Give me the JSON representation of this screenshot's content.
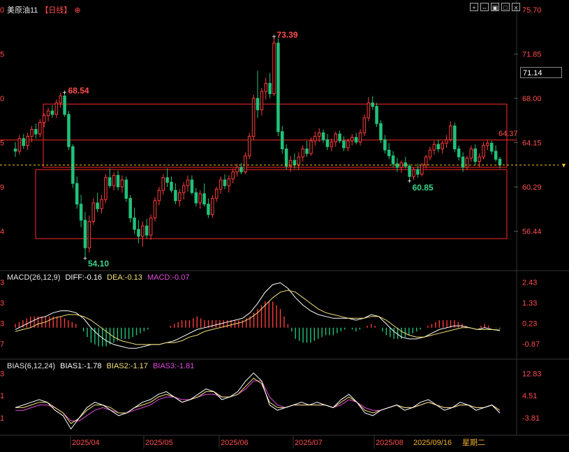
{
  "header": {
    "symbol": "美原油11",
    "period": "【日线】",
    "toolbar_icons": [
      "crosshair-icon",
      "expand-icon",
      "image-icon",
      "maximize-icon",
      "close-icon"
    ]
  },
  "price_panel": {
    "y_axis_labels": [
      "75.70",
      "71.85",
      "68.00",
      "64.15",
      "60.29",
      "56.44"
    ],
    "left_axis_partial": [
      "0",
      "5",
      "0",
      "5",
      "9",
      "4"
    ],
    "current_price": "71.14",
    "high_label": "73.39",
    "high_left_label": "68.54",
    "low_label": "54.10",
    "low_right_label": "60.85",
    "box_top_label": "64.37"
  },
  "macd_panel": {
    "title": "MACD(26,12,9)",
    "diff": "DIFF:-0.16",
    "dea": "DEA:-0.13",
    "macd": "MACD:-0.07",
    "y_axis_labels": [
      "2.43",
      "1.33",
      "0.23",
      "-0.87"
    ],
    "left_axis_partial": [
      "3",
      "3",
      "3",
      "7"
    ]
  },
  "bias_panel": {
    "title": "BIAS(6,12,24)",
    "bias1": "BIAS1:-1.78",
    "bias2": "BIAS2:-1.17",
    "bias3": "BIAS3:-1.81",
    "y_axis_labels": [
      "12.83",
      "4.51",
      "-3.81"
    ],
    "left_axis_partial": [
      "3",
      "1",
      "1"
    ]
  },
  "x_axis": {
    "labels": [
      "2025/04",
      "2025/05",
      "2025/06",
      "2025/07",
      "2025/08"
    ],
    "current_date": "2025/09/16",
    "weekday": "星期二"
  },
  "colors": {
    "up": "#ff3b3b",
    "down": "#21c27a",
    "diff": "#ffffff",
    "dea": "#f5e27a",
    "macd": "#e54be0",
    "bias1": "#ffffff",
    "bias2": "#f5e27a",
    "bias3": "#e54be0",
    "box": "#ff2a2a",
    "axis_text": "#ff4d4d",
    "label_up": "#ff4d4d",
    "label_down": "#3bd48a"
  },
  "chart_data": {
    "type": "candlestick",
    "price_range": [
      53.5,
      75.7
    ],
    "candles": [
      [
        63.6,
        64.2,
        62.9,
        63.4
      ],
      [
        63.4,
        64.8,
        63.1,
        64.5
      ],
      [
        64.5,
        64.9,
        63.6,
        63.9
      ],
      [
        63.9,
        65.0,
        63.5,
        64.7
      ],
      [
        64.7,
        65.6,
        64.2,
        65.3
      ],
      [
        65.3,
        65.8,
        64.5,
        64.9
      ],
      [
        64.9,
        66.2,
        64.6,
        65.9
      ],
      [
        65.9,
        66.7,
        65.5,
        66.5
      ],
      [
        66.5,
        67.2,
        66.0,
        66.9
      ],
      [
        66.9,
        67.4,
        66.3,
        66.6
      ],
      [
        66.6,
        67.9,
        66.3,
        67.6
      ],
      [
        67.6,
        68.5,
        67.2,
        68.2
      ],
      [
        68.2,
        68.54,
        66.4,
        66.6
      ],
      [
        66.6,
        66.9,
        63.5,
        63.8
      ],
      [
        63.8,
        64.0,
        60.2,
        60.6
      ],
      [
        60.6,
        61.2,
        58.4,
        58.8
      ],
      [
        58.8,
        59.6,
        56.8,
        57.4
      ],
      [
        57.4,
        58.1,
        54.1,
        55.0
      ],
      [
        55.0,
        57.8,
        54.6,
        57.3
      ],
      [
        57.3,
        59.3,
        57.0,
        58.9
      ],
      [
        58.9,
        59.8,
        58.1,
        58.4
      ],
      [
        58.4,
        59.6,
        58.0,
        59.2
      ],
      [
        59.2,
        61.4,
        58.9,
        61.1
      ],
      [
        61.1,
        61.9,
        60.2,
        60.4
      ],
      [
        60.4,
        61.6,
        60.0,
        61.3
      ],
      [
        61.3,
        61.7,
        60.0,
        60.3
      ],
      [
        60.3,
        61.3,
        59.8,
        60.9
      ],
      [
        60.9,
        61.2,
        59.0,
        59.3
      ],
      [
        59.3,
        59.6,
        57.2,
        57.6
      ],
      [
        57.6,
        58.5,
        56.2,
        56.6
      ],
      [
        56.6,
        57.4,
        55.4,
        56.0
      ],
      [
        56.0,
        57.3,
        55.1,
        56.9
      ],
      [
        56.9,
        57.5,
        55.8,
        56.1
      ],
      [
        56.1,
        57.9,
        55.7,
        57.6
      ],
      [
        57.6,
        59.4,
        57.3,
        59.1
      ],
      [
        59.1,
        60.3,
        58.7,
        60.0
      ],
      [
        60.0,
        61.4,
        59.6,
        61.1
      ],
      [
        61.1,
        61.9,
        60.3,
        60.7
      ],
      [
        60.7,
        61.2,
        59.8,
        60.0
      ],
      [
        60.0,
        60.6,
        58.8,
        59.1
      ],
      [
        59.1,
        60.1,
        58.6,
        59.8
      ],
      [
        59.8,
        60.7,
        59.2,
        60.4
      ],
      [
        60.4,
        61.3,
        59.9,
        60.9
      ],
      [
        60.9,
        61.3,
        59.6,
        59.8
      ],
      [
        59.8,
        60.2,
        58.6,
        58.9
      ],
      [
        58.9,
        60.0,
        58.4,
        59.7
      ],
      [
        59.7,
        60.6,
        58.6,
        58.8
      ],
      [
        58.8,
        59.3,
        57.6,
        57.9
      ],
      [
        57.9,
        59.6,
        57.6,
        59.3
      ],
      [
        59.3,
        60.3,
        59.0,
        60.1
      ],
      [
        60.1,
        61.2,
        59.7,
        60.9
      ],
      [
        60.9,
        61.4,
        60.1,
        60.4
      ],
      [
        60.4,
        61.3,
        59.8,
        61.0
      ],
      [
        61.0,
        61.9,
        60.6,
        61.6
      ],
      [
        61.6,
        62.3,
        61.2,
        62.0
      ],
      [
        62.0,
        62.4,
        61.4,
        61.6
      ],
      [
        61.6,
        63.3,
        61.4,
        63.0
      ],
      [
        63.0,
        65.0,
        62.7,
        64.7
      ],
      [
        64.7,
        68.3,
        64.4,
        68.0
      ],
      [
        68.0,
        70.4,
        66.3,
        67.0
      ],
      [
        67.0,
        68.9,
        66.5,
        68.6
      ],
      [
        68.6,
        69.8,
        67.9,
        69.3
      ],
      [
        69.3,
        70.2,
        68.0,
        68.4
      ],
      [
        68.4,
        73.39,
        68.2,
        72.8
      ],
      [
        72.8,
        73.2,
        64.7,
        65.1
      ],
      [
        65.1,
        65.6,
        63.2,
        63.6
      ],
      [
        63.6,
        64.0,
        61.8,
        62.1
      ],
      [
        62.1,
        63.0,
        61.6,
        62.6
      ],
      [
        62.6,
        63.2,
        61.9,
        62.2
      ],
      [
        62.2,
        63.3,
        61.8,
        62.9
      ],
      [
        62.9,
        63.9,
        62.5,
        63.6
      ],
      [
        63.6,
        64.3,
        62.9,
        63.2
      ],
      [
        63.2,
        64.6,
        63.0,
        64.3
      ],
      [
        64.3,
        65.1,
        63.9,
        64.7
      ],
      [
        64.7,
        65.4,
        64.2,
        65.0
      ],
      [
        65.0,
        65.3,
        64.1,
        64.4
      ],
      [
        64.4,
        64.9,
        63.5,
        63.8
      ],
      [
        63.8,
        64.5,
        63.4,
        64.2
      ],
      [
        64.2,
        65.1,
        63.8,
        64.9
      ],
      [
        64.9,
        65.2,
        64.1,
        64.3
      ],
      [
        64.3,
        64.7,
        63.4,
        63.7
      ],
      [
        63.7,
        64.5,
        63.4,
        64.3
      ],
      [
        64.3,
        64.9,
        63.9,
        64.6
      ],
      [
        64.6,
        65.0,
        64.0,
        64.2
      ],
      [
        64.2,
        65.3,
        63.9,
        65.0
      ],
      [
        65.0,
        66.6,
        64.7,
        66.3
      ],
      [
        66.3,
        68.1,
        66.0,
        67.6
      ],
      [
        67.6,
        68.2,
        67.0,
        67.3
      ],
      [
        67.3,
        67.6,
        65.5,
        65.8
      ],
      [
        65.8,
        66.1,
        64.1,
        64.4
      ],
      [
        64.4,
        64.8,
        63.2,
        63.5
      ],
      [
        63.5,
        64.1,
        62.7,
        63.0
      ],
      [
        63.0,
        63.4,
        62.0,
        62.3
      ],
      [
        62.3,
        62.8,
        61.6,
        62.0
      ],
      [
        62.0,
        62.6,
        61.5,
        62.4
      ],
      [
        62.4,
        62.9,
        61.9,
        62.1
      ],
      [
        62.1,
        62.3,
        60.85,
        61.2
      ],
      [
        61.2,
        62.0,
        60.9,
        61.8
      ],
      [
        61.8,
        62.3,
        61.1,
        61.4
      ],
      [
        61.4,
        62.4,
        61.2,
        62.2
      ],
      [
        62.2,
        63.1,
        61.9,
        62.9
      ],
      [
        62.9,
        63.8,
        62.6,
        63.5
      ],
      [
        63.5,
        64.3,
        63.1,
        64.0
      ],
      [
        64.0,
        64.4,
        63.3,
        63.6
      ],
      [
        63.6,
        64.3,
        63.2,
        64.1
      ],
      [
        64.1,
        64.8,
        63.7,
        64.4
      ],
      [
        64.4,
        66.0,
        64.2,
        65.6
      ],
      [
        65.6,
        65.9,
        63.3,
        63.6
      ],
      [
        63.6,
        63.9,
        62.6,
        62.9
      ],
      [
        62.9,
        63.3,
        61.6,
        62.0
      ],
      [
        62.0,
        63.0,
        61.8,
        62.8
      ],
      [
        62.8,
        63.9,
        62.5,
        63.6
      ],
      [
        63.6,
        64.0,
        62.2,
        62.5
      ],
      [
        62.5,
        63.2,
        62.0,
        62.9
      ],
      [
        62.9,
        64.2,
        62.7,
        63.9
      ],
      [
        63.9,
        64.37,
        63.5,
        64.1
      ],
      [
        64.1,
        64.3,
        63.1,
        63.4
      ],
      [
        63.4,
        63.9,
        62.5,
        62.7
      ],
      [
        62.7,
        62.9,
        61.9,
        62.2
      ]
    ],
    "box1_range": [
      62.0,
      67.5
    ],
    "box2_range": [
      55.8,
      61.8
    ],
    "macd": {
      "range": [
        -1.5,
        2.6
      ],
      "diff_points": [
        -0.1,
        0.1,
        0.3,
        0.5,
        0.6,
        0.8,
        0.9,
        0.9,
        0.8,
        0.5,
        0.0,
        -0.4,
        -0.7,
        -0.9,
        -1.0,
        -1.1,
        -1.1,
        -1.0,
        -0.9,
        -0.9,
        -0.8,
        -0.7,
        -0.5,
        -0.3,
        -0.1,
        0.0,
        0.1,
        0.2,
        0.3,
        0.4,
        0.5,
        0.8,
        1.3,
        1.9,
        2.3,
        2.4,
        2.1,
        1.6,
        1.2,
        0.9,
        0.7,
        0.6,
        0.5,
        0.5,
        0.5,
        0.4,
        0.5,
        0.7,
        0.6,
        0.2,
        -0.2,
        -0.5,
        -0.6,
        -0.6,
        -0.5,
        -0.3,
        -0.1,
        0.0,
        0.1,
        0.1,
        0.0,
        -0.1,
        0.0,
        -0.1,
        -0.16
      ],
      "dea_points": [
        -0.2,
        -0.1,
        0.0,
        0.2,
        0.3,
        0.5,
        0.6,
        0.7,
        0.7,
        0.6,
        0.4,
        0.1,
        -0.2,
        -0.5,
        -0.7,
        -0.8,
        -0.9,
        -0.9,
        -0.9,
        -0.9,
        -0.8,
        -0.8,
        -0.7,
        -0.5,
        -0.4,
        -0.2,
        -0.1,
        0.0,
        0.1,
        0.2,
        0.3,
        0.5,
        0.8,
        1.2,
        1.6,
        1.9,
        2.0,
        1.9,
        1.6,
        1.3,
        1.0,
        0.8,
        0.7,
        0.6,
        0.5,
        0.5,
        0.5,
        0.6,
        0.6,
        0.4,
        0.1,
        -0.2,
        -0.4,
        -0.5,
        -0.5,
        -0.4,
        -0.3,
        -0.2,
        -0.1,
        0.0,
        0.0,
        -0.1,
        -0.1,
        -0.1,
        -0.13
      ]
    },
    "bias": {
      "range": [
        -8,
        15
      ],
      "bias1_points": [
        0,
        1,
        2,
        3,
        2,
        -1,
        -3,
        -8,
        -4,
        0,
        2,
        1,
        -1,
        -3,
        -2,
        0,
        2,
        3,
        5,
        6,
        4,
        2,
        3,
        5,
        7,
        6,
        3,
        4,
        6,
        10,
        13,
        10,
        1,
        -1,
        0,
        1,
        2,
        1,
        2,
        1,
        0,
        3,
        5,
        2,
        -2,
        -3,
        -1,
        0,
        1,
        -1,
        0,
        2,
        3,
        1,
        -1,
        0,
        2,
        1,
        -1,
        0,
        1,
        -2
      ],
      "bias2_points": [
        0,
        0,
        1,
        2,
        2,
        0,
        -2,
        -6,
        -4,
        -1,
        1,
        1,
        0,
        -2,
        -2,
        0,
        1,
        2,
        4,
        5,
        4,
        2,
        3,
        4,
        6,
        6,
        4,
        4,
        5,
        8,
        11,
        9,
        2,
        0,
        0,
        1,
        1,
        1,
        1,
        1,
        0,
        2,
        4,
        2,
        -1,
        -2,
        -1,
        0,
        1,
        0,
        0,
        1,
        2,
        1,
        0,
        0,
        1,
        1,
        0,
        0,
        1,
        -1
      ],
      "bias3_points": [
        -1,
        -1,
        0,
        1,
        1,
        0,
        -2,
        -5,
        -5,
        -3,
        -1,
        0,
        -1,
        -2,
        -2,
        -1,
        0,
        1,
        3,
        4,
        4,
        3,
        3,
        4,
        5,
        5,
        4,
        4,
        5,
        7,
        10,
        10,
        4,
        1,
        0,
        1,
        1,
        1,
        1,
        1,
        0,
        1,
        3,
        2,
        0,
        -1,
        -1,
        0,
        1,
        0,
        0,
        1,
        2,
        1,
        0,
        0,
        1,
        1,
        0,
        0,
        1,
        -2
      ]
    }
  }
}
